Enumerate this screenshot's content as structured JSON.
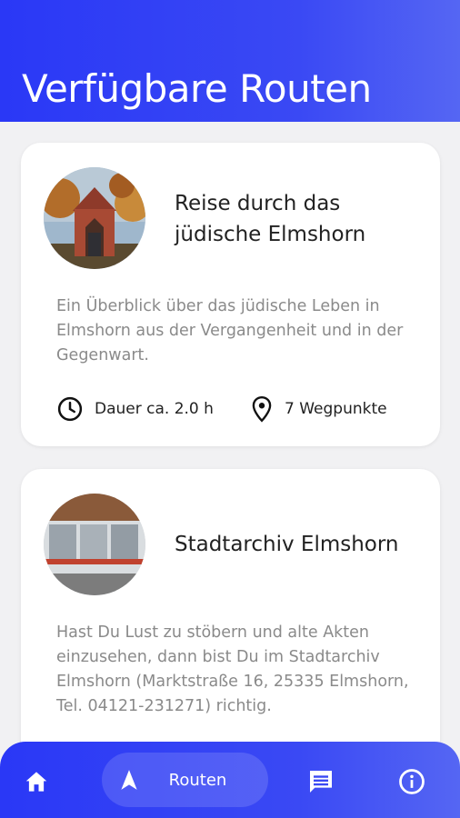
{
  "header": {
    "title": "Verfügbare Routen"
  },
  "routes": [
    {
      "title": "Reise durch das jüdische Elmshorn",
      "description": "Ein Überblick über das jüdische Leben in Elmshorn aus der Vergangenheit und in der Gegenwart.",
      "duration": "Dauer ca. 2.0 h",
      "waypoints": "7 Wegpunkte"
    },
    {
      "title": "Stadtarchiv Elmshorn",
      "description": "Hast Du Lust zu stöbern und alte Akten einzusehen, dann bist Du im Stadtarchiv Elmshorn (Marktstraße 16, 25335 Elmshorn, Tel. 04121-231271) richtig."
    }
  ],
  "nav": {
    "routes_label": "Routen",
    "icons": [
      "home-icon",
      "navigation-arrow-icon",
      "chat-icon",
      "info-icon"
    ]
  },
  "colors": {
    "accent": "#3a49f4",
    "card": "#ffffff",
    "background": "#f1f1f3"
  }
}
